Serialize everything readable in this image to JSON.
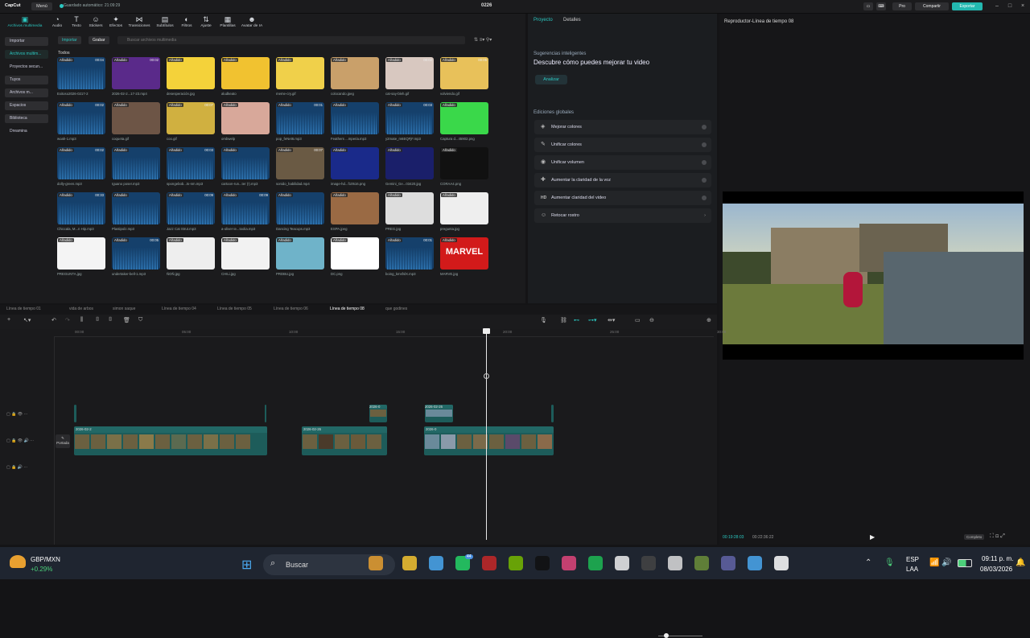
{
  "app": {
    "logo": "CapCut",
    "menu": "Menú",
    "autosave": "Guardado automático: 21:09:29",
    "project_title": "0226",
    "pro": "Pro",
    "share": "Compartir",
    "export": "Exportar"
  },
  "toolbar": [
    {
      "label": "Archivos multimedia",
      "icon": "media-icon"
    },
    {
      "label": "Audio",
      "icon": "audio-icon"
    },
    {
      "label": "Texto",
      "icon": "text-icon"
    },
    {
      "label": "Stickers",
      "icon": "sticker-icon"
    },
    {
      "label": "Efectos",
      "icon": "effects-icon"
    },
    {
      "label": "Transiciones",
      "icon": "transitions-icon"
    },
    {
      "label": "Subtítulos",
      "icon": "subtitles-icon"
    },
    {
      "label": "Filtros",
      "icon": "filters-icon"
    },
    {
      "label": "Ajuste",
      "icon": "adjust-icon"
    },
    {
      "label": "Plantillas",
      "icon": "templates-icon"
    },
    {
      "label": "Avatar de IA",
      "icon": "avatar-icon"
    }
  ],
  "sidebar": [
    {
      "label": "Importar"
    },
    {
      "label": "Archivos multim..."
    },
    {
      "label": "Proyectos secun..."
    },
    {
      "label": "Tuyos"
    },
    {
      "label": "Archivos m..."
    },
    {
      "label": "Espacios"
    },
    {
      "label": "Biblioteca"
    },
    {
      "label": "Dreamina"
    }
  ],
  "media": {
    "import": "Importar",
    "record": "Grabar",
    "search_placeholder": "Buscar archivos multimedia",
    "group": "Todos",
    "added": "Añadido",
    "items": [
      {
        "name": "Exitoso2026-0217-2",
        "dur": "00:04",
        "kind": "audio"
      },
      {
        "name": "2026-02-2...17-23.mp4",
        "dur": "00:02",
        "kind": "video",
        "color": "#5a2a8a"
      },
      {
        "name": "desesperación.jpg",
        "dur": "",
        "kind": "image",
        "color": "#f4d23a"
      },
      {
        "name": "aludkeato",
        "dur": "",
        "kind": "image",
        "color": "#f1c230"
      },
      {
        "name": "meme-cry.gif",
        "dur": "",
        "kind": "image",
        "color": "#f0d04a"
      },
      {
        "name": "colocando.jpeg",
        "dur": "",
        "kind": "image",
        "color": "#c9a06a"
      },
      {
        "name": "cat-say-bleh.gif",
        "dur": "00:02",
        "kind": "image",
        "color": "#d8c8c0"
      },
      {
        "name": "volviendo.gif",
        "dur": "00:05",
        "kind": "image",
        "color": "#e8c15a"
      },
      {
        "name": "woah-1.mp3",
        "dur": "00:02",
        "kind": "audio"
      },
      {
        "name": "coqueta.gif",
        "dur": "",
        "kind": "image",
        "color": "#6d5546"
      },
      {
        "name": "coo.gif",
        "dur": "00:07",
        "kind": "image",
        "color": "#d0b040"
      },
      {
        "name": "ombwelp",
        "dur": "",
        "kind": "image",
        "color": "#d8a89a"
      },
      {
        "name": "pop_feNet6.mp3",
        "dur": "00:01",
        "kind": "audio"
      },
      {
        "name": "Feathers ...mperia.mp3",
        "dur": "",
        "kind": "audio"
      },
      {
        "name": "y2mate_m6EQFjF.mp3",
        "dur": "00:03",
        "kind": "audio"
      },
      {
        "name": "Captura d...45902.png",
        "dur": "",
        "kind": "image",
        "color": "#3ad84a"
      },
      {
        "name": "dolly-green.mp3",
        "dur": "00:02",
        "kind": "audio"
      },
      {
        "name": "Iguano poser.mp3",
        "dur": "",
        "kind": "audio"
      },
      {
        "name": "spongebob...ts-nm.mp3",
        "dur": "00:03",
        "kind": "audio"
      },
      {
        "name": "cartoon-run...ter (!).mp3",
        "dur": "",
        "kind": "audio"
      },
      {
        "name": "sonido_habilidad.mp4",
        "dur": "00:07",
        "kind": "video",
        "color": "#6a5a44"
      },
      {
        "name": "image-hd...f10516.png",
        "dur": "",
        "kind": "image",
        "color": "#1a2a8a"
      },
      {
        "name": "Gemini_Ge...03420.jpg",
        "dur": "",
        "kind": "image",
        "color": "#1a1f6a"
      },
      {
        "name": "CORAA4.png",
        "dur": "",
        "kind": "image",
        "color": "#111"
      },
      {
        "name": "Chiccala, M...n Hip.mp3",
        "dur": "00:33",
        "kind": "audio"
      },
      {
        "name": "Plastipolz.mp3",
        "dur": "",
        "kind": "audio"
      },
      {
        "name": "Jazz Cat Strut.mp3",
        "dur": "00:09",
        "kind": "audio"
      },
      {
        "name": "a-oliver-ie...toolia.mp3",
        "dur": "00:09",
        "kind": "audio"
      },
      {
        "name": "Dancing Teacups.mp3",
        "dur": "",
        "kind": "audio"
      },
      {
        "name": "ESPA.jpeg",
        "dur": "",
        "kind": "image",
        "color": "#9a6a44"
      },
      {
        "name": "PREG.jpg",
        "dur": "",
        "kind": "image",
        "color": "#ddd"
      },
      {
        "name": "pregunta.jpg",
        "dur": "",
        "kind": "image",
        "color": "#eee"
      },
      {
        "name": "PREGUNTA.jpg",
        "dur": "",
        "kind": "image",
        "color": "#f4f4f4"
      },
      {
        "name": "undertaker-bell-1.mp3",
        "dur": "00:05",
        "kind": "audio"
      },
      {
        "name": "ÑOÑ.jpg",
        "dur": "",
        "kind": "image",
        "color": "#eee"
      },
      {
        "name": "CHILi.jpg",
        "dur": "",
        "kind": "image",
        "color": "#f2f2f2"
      },
      {
        "name": "PRDBU.jpg",
        "dur": "",
        "kind": "image",
        "color": "#6fb3c9"
      },
      {
        "name": "DC.png",
        "dur": "",
        "kind": "image",
        "color": "#fff"
      },
      {
        "name": "boing_kmsfslX.mp3",
        "dur": "00:01",
        "kind": "audio"
      },
      {
        "name": "MARVE.jpg",
        "dur": "",
        "kind": "image",
        "color": "#d21a1a",
        "text": "MARVEL"
      }
    ]
  },
  "project": {
    "tab1": "Proyecto",
    "tab2": "Detalles",
    "sug_title": "Sugerencias inteligentes",
    "sug_text": "Descubre cómo puedes mejorar tu video",
    "analyze": "Analizar",
    "global_title": "Ediciones globales",
    "global": [
      {
        "label": "Mejorar colores",
        "icon": "palette-icon"
      },
      {
        "label": "Unificar colores",
        "icon": "brush-icon"
      },
      {
        "label": "Unificar volumen",
        "icon": "volume-icon"
      },
      {
        "label": "Aumentar la claridad de la voz",
        "icon": "voice-icon"
      },
      {
        "label": "Aumentar claridad del video",
        "icon": "hd-icon",
        "prefix": "HD"
      },
      {
        "label": "Retocar rostro",
        "icon": "face-icon"
      }
    ]
  },
  "player": {
    "title": "Reproductor-Línea de tiempo 08",
    "current": "00:19:28:03",
    "total": "00:22:36:22",
    "ratio": "Completo"
  },
  "timeline_tabs": [
    "Línea de tiempo 01",
    "vida de arbos",
    "simon saque",
    "Línea de tiempo 04",
    "Línea de tiempo 05",
    "Línea de tiempo 06",
    "Línea de tiempo 08",
    "que godines"
  ],
  "ruler": [
    "00:00",
    "05:00",
    "10:00",
    "15:00",
    "20:00",
    "25:00",
    "30:00"
  ],
  "cover": "Portada",
  "clips_top": [
    {
      "label": "2026-0"
    },
    {
      "label": "2026-02-26"
    }
  ],
  "clips_main": [
    {
      "label": "2026-02-2"
    },
    {
      "label": "2026-02-26"
    },
    {
      "label": "2026-0"
    }
  ],
  "taskbar": {
    "ticker": "GBP/MXN",
    "change": "+0.29%",
    "search": "Buscar",
    "lang1": "ESP",
    "lang2": "LAA",
    "time": "09:11 p. m.",
    "date": "08/03/2026",
    "notif": "44"
  }
}
